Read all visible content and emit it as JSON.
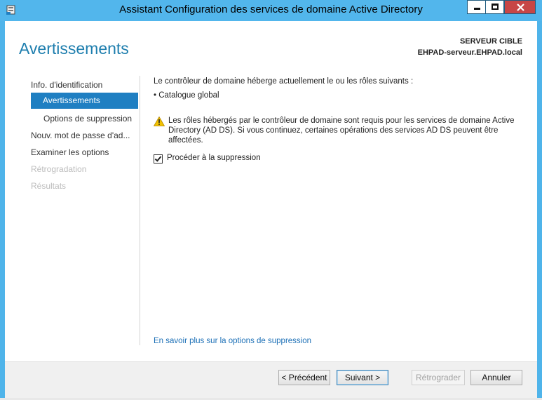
{
  "window": {
    "title": "Assistant Configuration des services de domaine Active Directory",
    "icon": "server-manager-icon"
  },
  "header": {
    "heading": "Avertissements",
    "target_label": "SERVEUR CIBLE",
    "target_name": "EHPAD-serveur.EHPAD.local"
  },
  "nav": {
    "items": [
      {
        "label": "Info. d'identification",
        "state": "normal"
      },
      {
        "label": "Avertissements",
        "state": "active"
      },
      {
        "label": "Options de suppression",
        "state": "normal"
      },
      {
        "label": "Nouv. mot de passe d'ad...",
        "state": "normal"
      },
      {
        "label": "Examiner les options",
        "state": "normal"
      },
      {
        "label": "Rétrogradation",
        "state": "disabled"
      },
      {
        "label": "Résultats",
        "state": "disabled"
      }
    ]
  },
  "content": {
    "intro": "Le contrôleur de domaine héberge actuellement le ou les rôles suivants :",
    "bullet": "Catalogue global",
    "warning": "Les rôles hébergés par le contrôleur de domaine sont requis pour les services de domaine Active Directory (AD DS). Si vous continuez, certaines opérations des services AD DS peuvent être affectées.",
    "warning_icon": "warning-icon",
    "checkbox_label": "Procéder à la suppression",
    "checkbox_checked": true,
    "learn_more": "En savoir plus sur la options de suppression"
  },
  "footer": {
    "previous": "< Précédent",
    "next": "Suivant >",
    "demote": "Rétrograder",
    "cancel": "Annuler"
  },
  "colors": {
    "titlebar": "#52b6ec",
    "accent": "#1f7fc2",
    "heading": "#1e7eae",
    "close_button": "#c74646",
    "link": "#1b6fb6"
  }
}
